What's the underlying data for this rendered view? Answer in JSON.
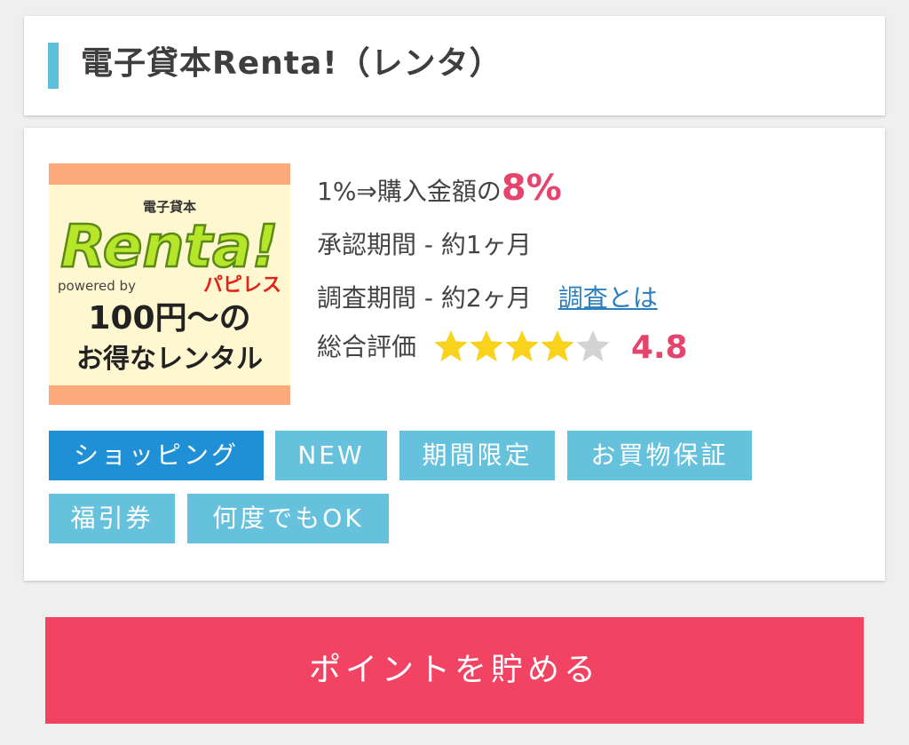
{
  "title": "電子貸本Renta!（レンタ）",
  "logo": {
    "top_text": "電子貸本",
    "brand": "Renta!",
    "powered": "powered by",
    "partner": "パピレス",
    "line1": "100円～の",
    "line2": "お得なレンタル",
    "colors": {
      "stripe": "#fdaa7a",
      "background": "#fff7d0",
      "brand_fill": "#b6e52a",
      "brand_outline": "#5a8a15",
      "partner": "#e2231a"
    }
  },
  "rate": {
    "prefix": "1%⇒購入金額の",
    "value": "8%"
  },
  "approval": "承認期間 - 約1ヶ月",
  "survey": {
    "text": "調査期間 - 約2ヶ月",
    "link": "調査とは"
  },
  "rating": {
    "label": "総合評価",
    "score": "4.8",
    "filled_stars": 4,
    "total_stars": 5
  },
  "tags": [
    "ショッピング",
    "NEW",
    "期間限定",
    "お買物保証",
    "福引券",
    "何度でもOK"
  ],
  "cta": "ポイントを貯める",
  "colors": {
    "accent": "#e5446c",
    "cta": "#f24363",
    "tag": "#66c1dc",
    "tag_primary": "#1f8fd6",
    "title_bar": "#5cc0dd",
    "star_on": "#f9d21c",
    "star_off": "#d3d3d3"
  }
}
